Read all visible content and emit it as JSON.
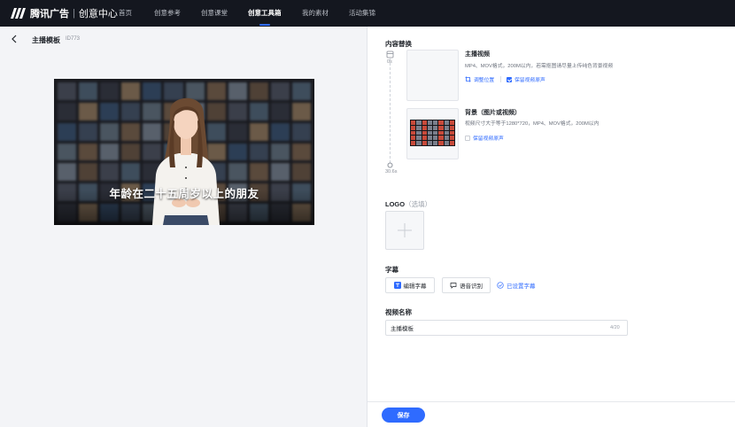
{
  "brand": {
    "name": "腾讯广告",
    "sub": "创意中心"
  },
  "nav": {
    "items": [
      {
        "label": "首页",
        "active": false
      },
      {
        "label": "创意参考",
        "active": false
      },
      {
        "label": "创意课堂",
        "active": false
      },
      {
        "label": "创意工具箱",
        "active": true
      },
      {
        "label": "我的素材",
        "active": false
      },
      {
        "label": "活动集锦",
        "active": false
      }
    ]
  },
  "page": {
    "title": "主播模板",
    "id": "ID773"
  },
  "preview": {
    "subtitle": "年龄在二十五周岁以上的朋友"
  },
  "content_replace": {
    "title": "内容替换",
    "timeline": {
      "start": "0s",
      "end": "30.6s"
    },
    "items": [
      {
        "title": "主播视频",
        "desc": "MP4、MOV格式，200M以内，若需抠图请尽量上传纯色背景视频",
        "options": [
          {
            "label": "调整位置",
            "icon": "crop-icon"
          },
          {
            "label": "保留视频原声",
            "checked": true
          }
        ]
      },
      {
        "title": "背景（图片或视频）",
        "desc": "视频尺寸大于等于1280*720，MP4、MOV格式，200M以内",
        "options": [
          {
            "label": "保留视频原声",
            "checked": false
          }
        ]
      }
    ]
  },
  "logo": {
    "title": "LOGO",
    "hint": "（选填）"
  },
  "subtitles": {
    "title": "字幕",
    "edit_label": "编辑字幕",
    "recognize_label": "语音识别",
    "status_label": "已设置字幕"
  },
  "video_name": {
    "title": "视频名称",
    "value": "主播模板",
    "counter": "4/20"
  },
  "footer": {
    "save_label": "保存"
  },
  "colors": {
    "accent": "#2f6bff",
    "nav_bg": "#14171f"
  }
}
